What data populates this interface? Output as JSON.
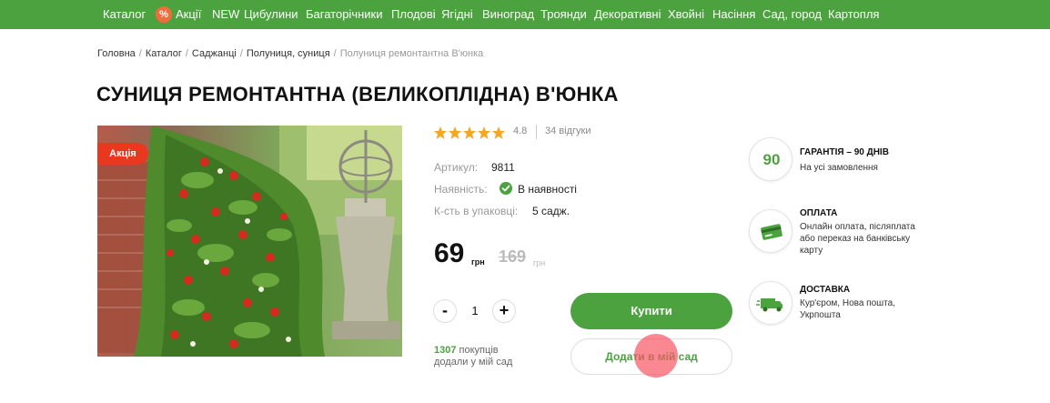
{
  "nav": {
    "items": [
      "Каталог",
      "Акції",
      "NEW",
      "Цибулини",
      "Багаторічники",
      "Плодові",
      "Ягідні",
      "Виноград",
      "Троянди",
      "Декоративні",
      "Хвойні",
      "Насіння",
      "Сад, город",
      "Картопля"
    ],
    "sale_badge": "%"
  },
  "breadcrumb": [
    "Головна",
    "Каталог",
    "Саджанці",
    "Полуниця, суниця",
    "Полуниця ремонтантна В'юнка"
  ],
  "product": {
    "title": "СУНИЦЯ РЕМОНТАНТНА (ВЕЛИКОПЛІДНА) В'ЮНКА",
    "sale_tag": "Акція",
    "rating": "4.8",
    "rating_stars": 5,
    "reviews": "34 відгуки",
    "article_label": "Артикул:",
    "article_value": "9811",
    "stock_label": "Наявність:",
    "stock_value": "В наявності",
    "pack_label": "К-сть в упаковці:",
    "pack_value": "5 садж.",
    "price": "69",
    "price_currency": "грн",
    "old_price": "169",
    "old_price_currency": "грн",
    "quantity": "1",
    "minus": "-",
    "plus": "+",
    "buy_label": "Купити",
    "garden_label": "Додати в мій сад",
    "buyers_count": "1307",
    "buyers_text_1": "покупців",
    "buyers_text_2": "додали у мій сад"
  },
  "features": [
    {
      "badge": "90",
      "title": "ГАРАНТІЯ – 90 ДНІВ",
      "lines": [
        "На усі замовлення"
      ],
      "icon": "guarantee-icon"
    },
    {
      "title": "ОПЛАТА",
      "lines": [
        "Онлайн оплата, післяплата",
        "або переказ на банківську",
        "карту"
      ],
      "icon": "payment-card-icon"
    },
    {
      "title": "ДОСТАВКА",
      "lines": [
        "Кур'єром, Нова пошта,",
        "Укрпошта"
      ],
      "icon": "delivery-truck-icon"
    }
  ],
  "colors": {
    "brand_green": "#4ca23f",
    "sale_red": "#e8381f",
    "star": "#f5a623"
  }
}
